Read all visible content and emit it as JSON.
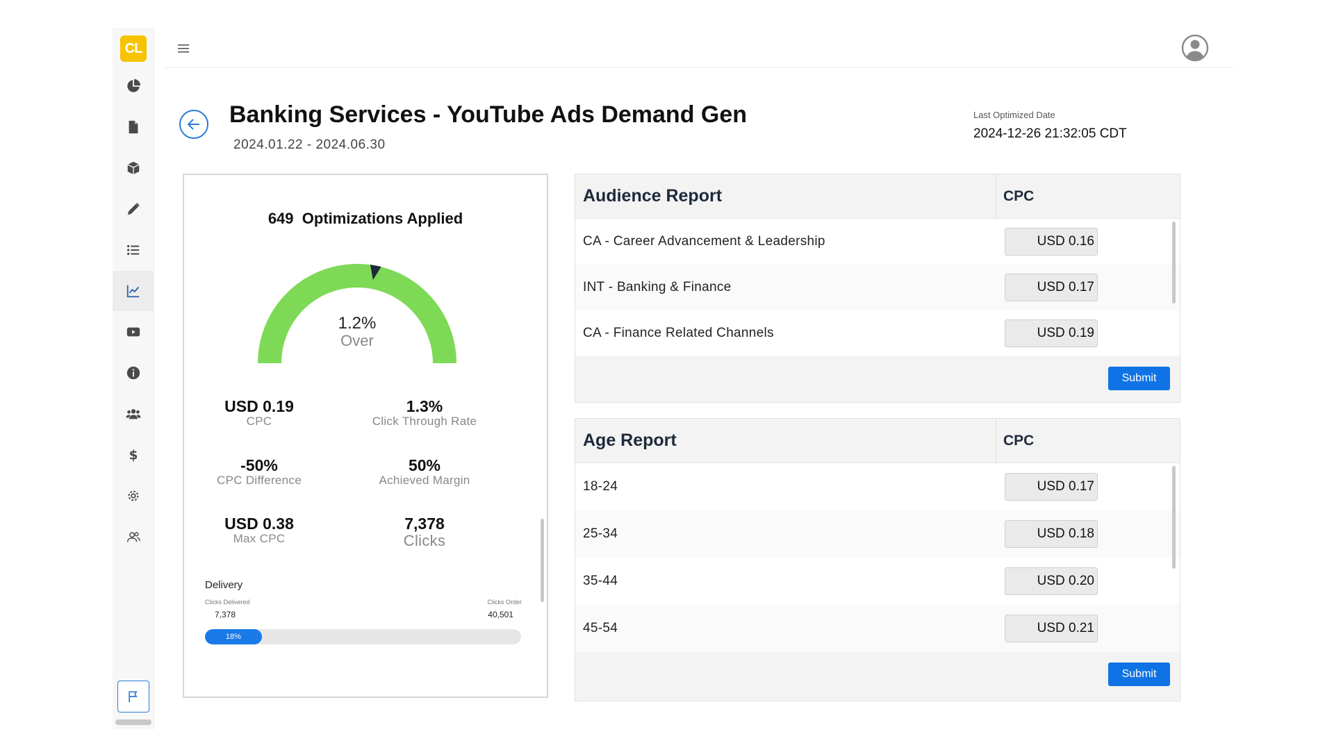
{
  "app": {
    "logo_text": "CL"
  },
  "sidebar": {
    "items": [
      {
        "icon": "pie-chart-icon"
      },
      {
        "icon": "document-icon"
      },
      {
        "icon": "box-icon"
      },
      {
        "icon": "pencil-icon"
      },
      {
        "icon": "list-icon"
      },
      {
        "icon": "line-chart-icon",
        "active": true
      },
      {
        "icon": "video-icon"
      },
      {
        "icon": "info-icon"
      },
      {
        "icon": "users-icon"
      },
      {
        "icon": "dollar-icon"
      },
      {
        "icon": "gear-icon"
      },
      {
        "icon": "user-group-icon"
      }
    ],
    "bottom_icon": "flag-icon"
  },
  "header": {
    "title": "Banking Services - YouTube Ads Demand Gen",
    "date_range": "2024.01.22 - 2024.06.30",
    "last_optimized_label": "Last Optimized Date",
    "last_optimized_value": "2024-12-26 21:32:05 CDT"
  },
  "summary": {
    "optimizations_count": "649",
    "optimizations_label": "Optimizations Applied",
    "gauge_value": "1.2%",
    "gauge_status": "Over",
    "gauge_level": 0.56,
    "colors": {
      "gauge": "#7ed957",
      "accent": "#1a7ae8"
    },
    "metrics": [
      {
        "value": "USD 0.19",
        "label": "CPC"
      },
      {
        "value": "1.3%",
        "label": "Click Through Rate"
      },
      {
        "value": "-50%",
        "label": "CPC Difference"
      },
      {
        "value": "50%",
        "label": "Achieved Margin"
      },
      {
        "value": "USD 0.38",
        "label": "Max CPC"
      },
      {
        "value": "7,378",
        "label": "Clicks"
      }
    ],
    "delivery": {
      "title": "Delivery",
      "delivered_label": "Clicks Delivered",
      "delivered_value": "7,378",
      "order_label": "Clicks Order",
      "order_value": "40,501",
      "progress_text": "18%",
      "progress_fraction": 0.18
    }
  },
  "audience_report": {
    "title": "Audience Report",
    "cpc_header": "CPC",
    "rows": [
      {
        "name": "CA - Career Advancement & Leadership",
        "cpc": "USD 0.16"
      },
      {
        "name": "INT - Banking & Finance",
        "cpc": "USD 0.17"
      },
      {
        "name": "CA - Finance Related Channels",
        "cpc": "USD 0.19"
      }
    ],
    "submit_label": "Submit"
  },
  "age_report": {
    "title": "Age Report",
    "cpc_header": "CPC",
    "rows": [
      {
        "name": "18-24",
        "cpc": "USD 0.17"
      },
      {
        "name": "25-34",
        "cpc": "USD 0.18"
      },
      {
        "name": "35-44",
        "cpc": "USD 0.20"
      },
      {
        "name": "45-54",
        "cpc": "USD 0.21"
      }
    ],
    "submit_label": "Submit"
  }
}
